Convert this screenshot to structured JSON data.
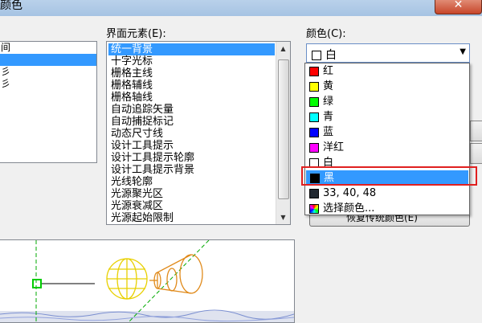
{
  "window": {
    "title_fragment": "颜色"
  },
  "labels": {
    "interface_elements": "界面元素(E):",
    "color": "颜色(C):"
  },
  "left_list": {
    "items": [
      "间",
      "",
      "彡",
      "彡"
    ]
  },
  "interface_elements": {
    "items": [
      "统一背景",
      "十字光标",
      "栅格主线",
      "栅格辅线",
      "栅格轴线",
      "自动追踪矢量",
      "自动捕捉标记",
      "动态尺寸线",
      "设计工具提示",
      "设计工具提示轮廓",
      "设计工具提示背景",
      "光线轮廓",
      "光源聚光区",
      "光源衰减区",
      "光源起始限制"
    ],
    "selected_index": 0
  },
  "color_combo": {
    "value": "白",
    "swatch": "#ffffff"
  },
  "color_options": [
    {
      "label": "红",
      "swatch": "#ff0000"
    },
    {
      "label": "黄",
      "swatch": "#ffff00"
    },
    {
      "label": "绿",
      "swatch": "#00ff00"
    },
    {
      "label": "青",
      "swatch": "#00ffff"
    },
    {
      "label": "蓝",
      "swatch": "#0000ff"
    },
    {
      "label": "洋红",
      "swatch": "#ff00ff"
    },
    {
      "label": "白",
      "swatch": "#ffffff"
    },
    {
      "label": "黑",
      "swatch": "#000000"
    },
    {
      "label": "33, 40, 48",
      "swatch": "#212830"
    },
    {
      "label": "选择颜色...",
      "swatch": "multicolor"
    }
  ],
  "highlighted_option_index": 7,
  "restore_button": {
    "label": "恢复传统颜色(E)"
  }
}
